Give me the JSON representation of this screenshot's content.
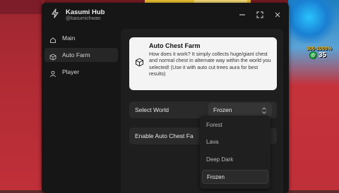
{
  "app": {
    "title": "Kasumi Hub",
    "subtitle": "@kasumichwan"
  },
  "sidebar": {
    "items": [
      {
        "label": "Main",
        "icon": "home-icon"
      },
      {
        "label": "Auto Farm",
        "icon": "box-icon",
        "active": true
      },
      {
        "label": "Player",
        "icon": "user-icon"
      }
    ]
  },
  "info": {
    "title": "Auto Chest Farm",
    "description": "How does it work? It simply collects huge/giant chest and normal chest in alternate way within the world you selected! (Use it with auto cut trees aura for best results)"
  },
  "select_world": {
    "label": "Select World",
    "value": "Frozen",
    "options": [
      "Forest",
      "Lava",
      "Deep Dark",
      "Frozen"
    ]
  },
  "enable_row": {
    "label": "Enable Auto Chest Fa",
    "enabled": false
  },
  "hud": {
    "range": "300-1000%",
    "count": "35"
  },
  "colors": {
    "window_bg": "#161616",
    "panel_bg": "#1e1e1e",
    "card_bg": "#f4f4f4",
    "accent": "#2bc24a"
  }
}
